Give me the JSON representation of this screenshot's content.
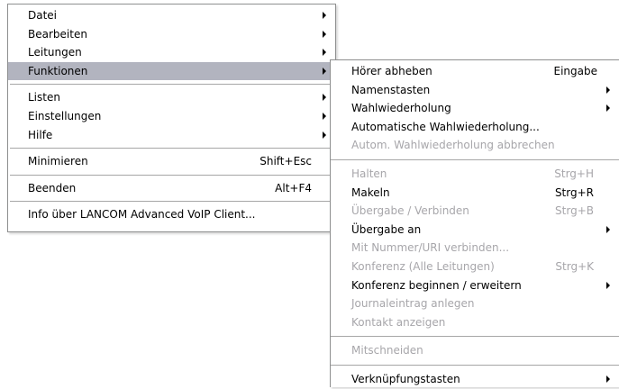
{
  "main_menu": {
    "items": [
      {
        "label": "Datei",
        "submenu": true
      },
      {
        "label": "Bearbeiten",
        "submenu": true
      },
      {
        "label": "Leitungen",
        "submenu": true
      },
      {
        "label": "Funktionen",
        "submenu": true,
        "highlighted": true
      },
      {
        "label": "Listen",
        "submenu": true
      },
      {
        "label": "Einstellungen",
        "submenu": true
      },
      {
        "label": "Hilfe",
        "submenu": true
      },
      {
        "label": "Minimieren",
        "shortcut": "Shift+Esc"
      },
      {
        "label": "Beenden",
        "shortcut": "Alt+F4"
      },
      {
        "label": "Info über LANCOM Advanced VoIP Client..."
      }
    ]
  },
  "submenu_funktionen": {
    "items": [
      {
        "label": "Hörer abheben",
        "shortcut": "Eingabe"
      },
      {
        "label": "Namenstasten",
        "submenu": true
      },
      {
        "label": "Wahlwiederholung",
        "submenu": true
      },
      {
        "label": "Automatische Wahlwiederholung..."
      },
      {
        "label": "Autom. Wahlwiederholung abbrechen",
        "disabled": true
      },
      {
        "label": "Halten",
        "shortcut": "Strg+H",
        "disabled": true
      },
      {
        "label": "Makeln",
        "shortcut": "Strg+R"
      },
      {
        "label": "Übergabe / Verbinden",
        "shortcut": "Strg+B",
        "disabled": true
      },
      {
        "label": "Übergabe an",
        "submenu": true
      },
      {
        "label": "Mit Nummer/URI verbinden...",
        "disabled": true
      },
      {
        "label": "Konferenz (Alle Leitungen)",
        "shortcut": "Strg+K",
        "disabled": true
      },
      {
        "label": "Konferenz beginnen / erweitern",
        "submenu": true
      },
      {
        "label": "Journaleintrag anlegen",
        "disabled": true
      },
      {
        "label": "Kontakt anzeigen",
        "disabled": true
      },
      {
        "label": "Mitschneiden",
        "disabled": true
      },
      {
        "label": "Verknüpfungstasten",
        "submenu": true
      }
    ]
  },
  "colors": {
    "highlight": "#b2b4bf",
    "disabled_text": "#a7a6aa",
    "border": "#8e8f8f"
  }
}
